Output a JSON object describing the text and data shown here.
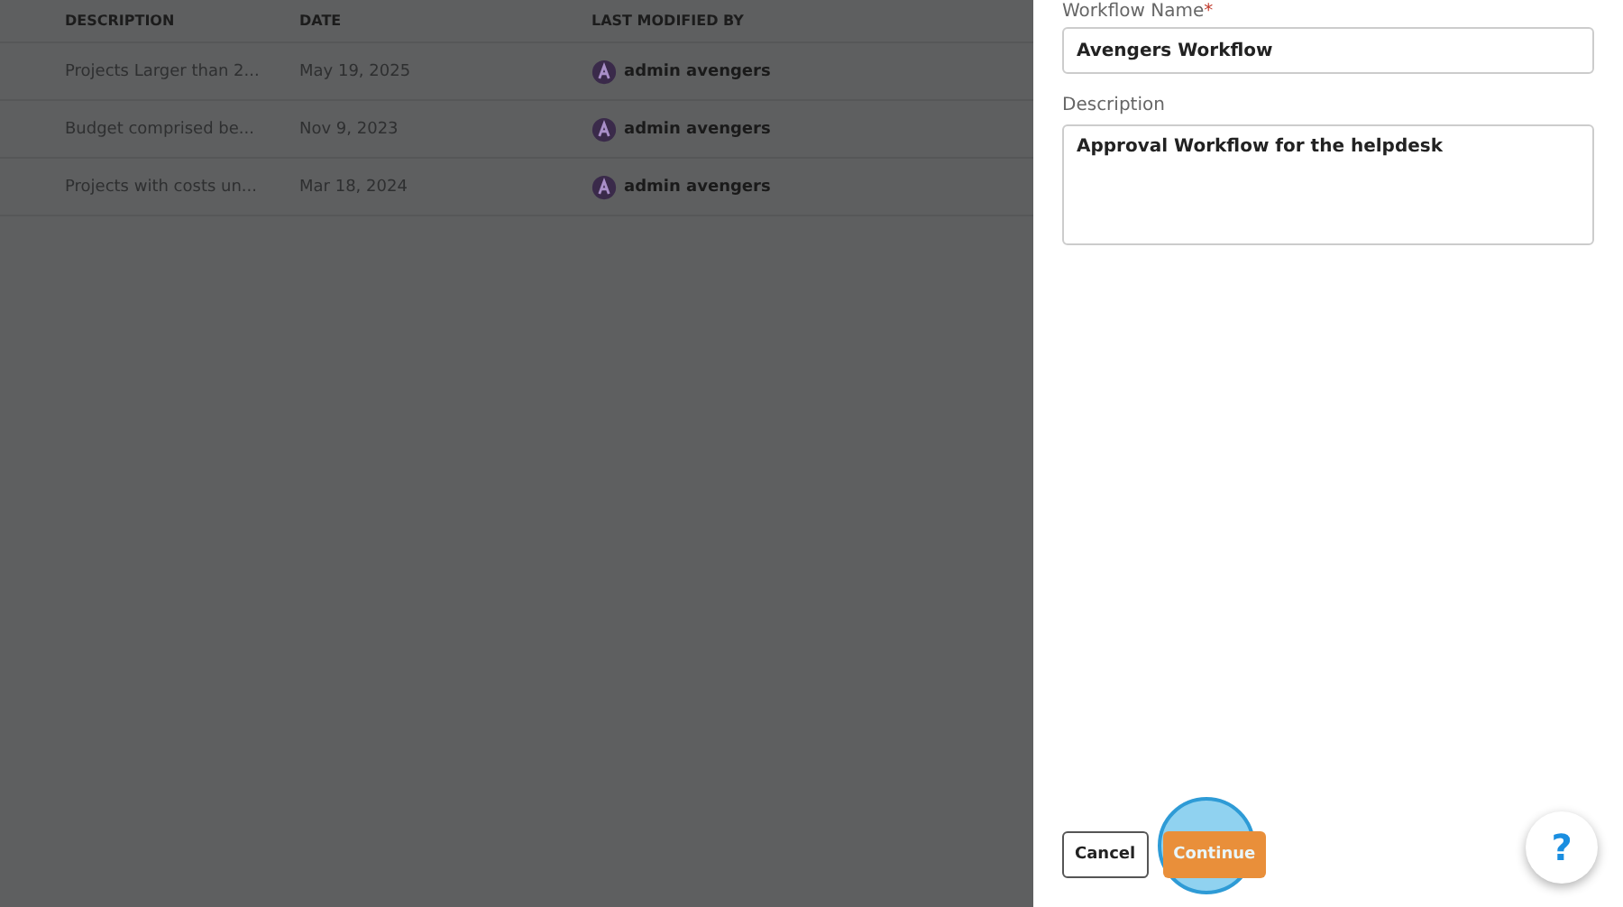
{
  "table": {
    "columns": [
      "DESCRIPTION",
      "DATE",
      "LAST MODIFIED BY"
    ],
    "rows": [
      {
        "description": "Projects Larger than 2...",
        "date": "May 19, 2025",
        "modified_by": "admin avengers"
      },
      {
        "description": "Budget comprised be...",
        "date": "Nov 9, 2023",
        "modified_by": "admin avengers"
      },
      {
        "description": "Projects with costs un...",
        "date": "Mar 18, 2024",
        "modified_by": "admin avengers"
      }
    ]
  },
  "panel": {
    "name_label": "Workflow Name",
    "required_mark": "*",
    "name_value": "Avengers Workflow",
    "description_label": "Description",
    "description_value": "Approval Workflow for the helpdesk",
    "buttons": [
      {
        "label": "Cancel",
        "kind": "secondary"
      },
      {
        "label": "Continue",
        "kind": "primary"
      }
    ],
    "help": "?"
  }
}
